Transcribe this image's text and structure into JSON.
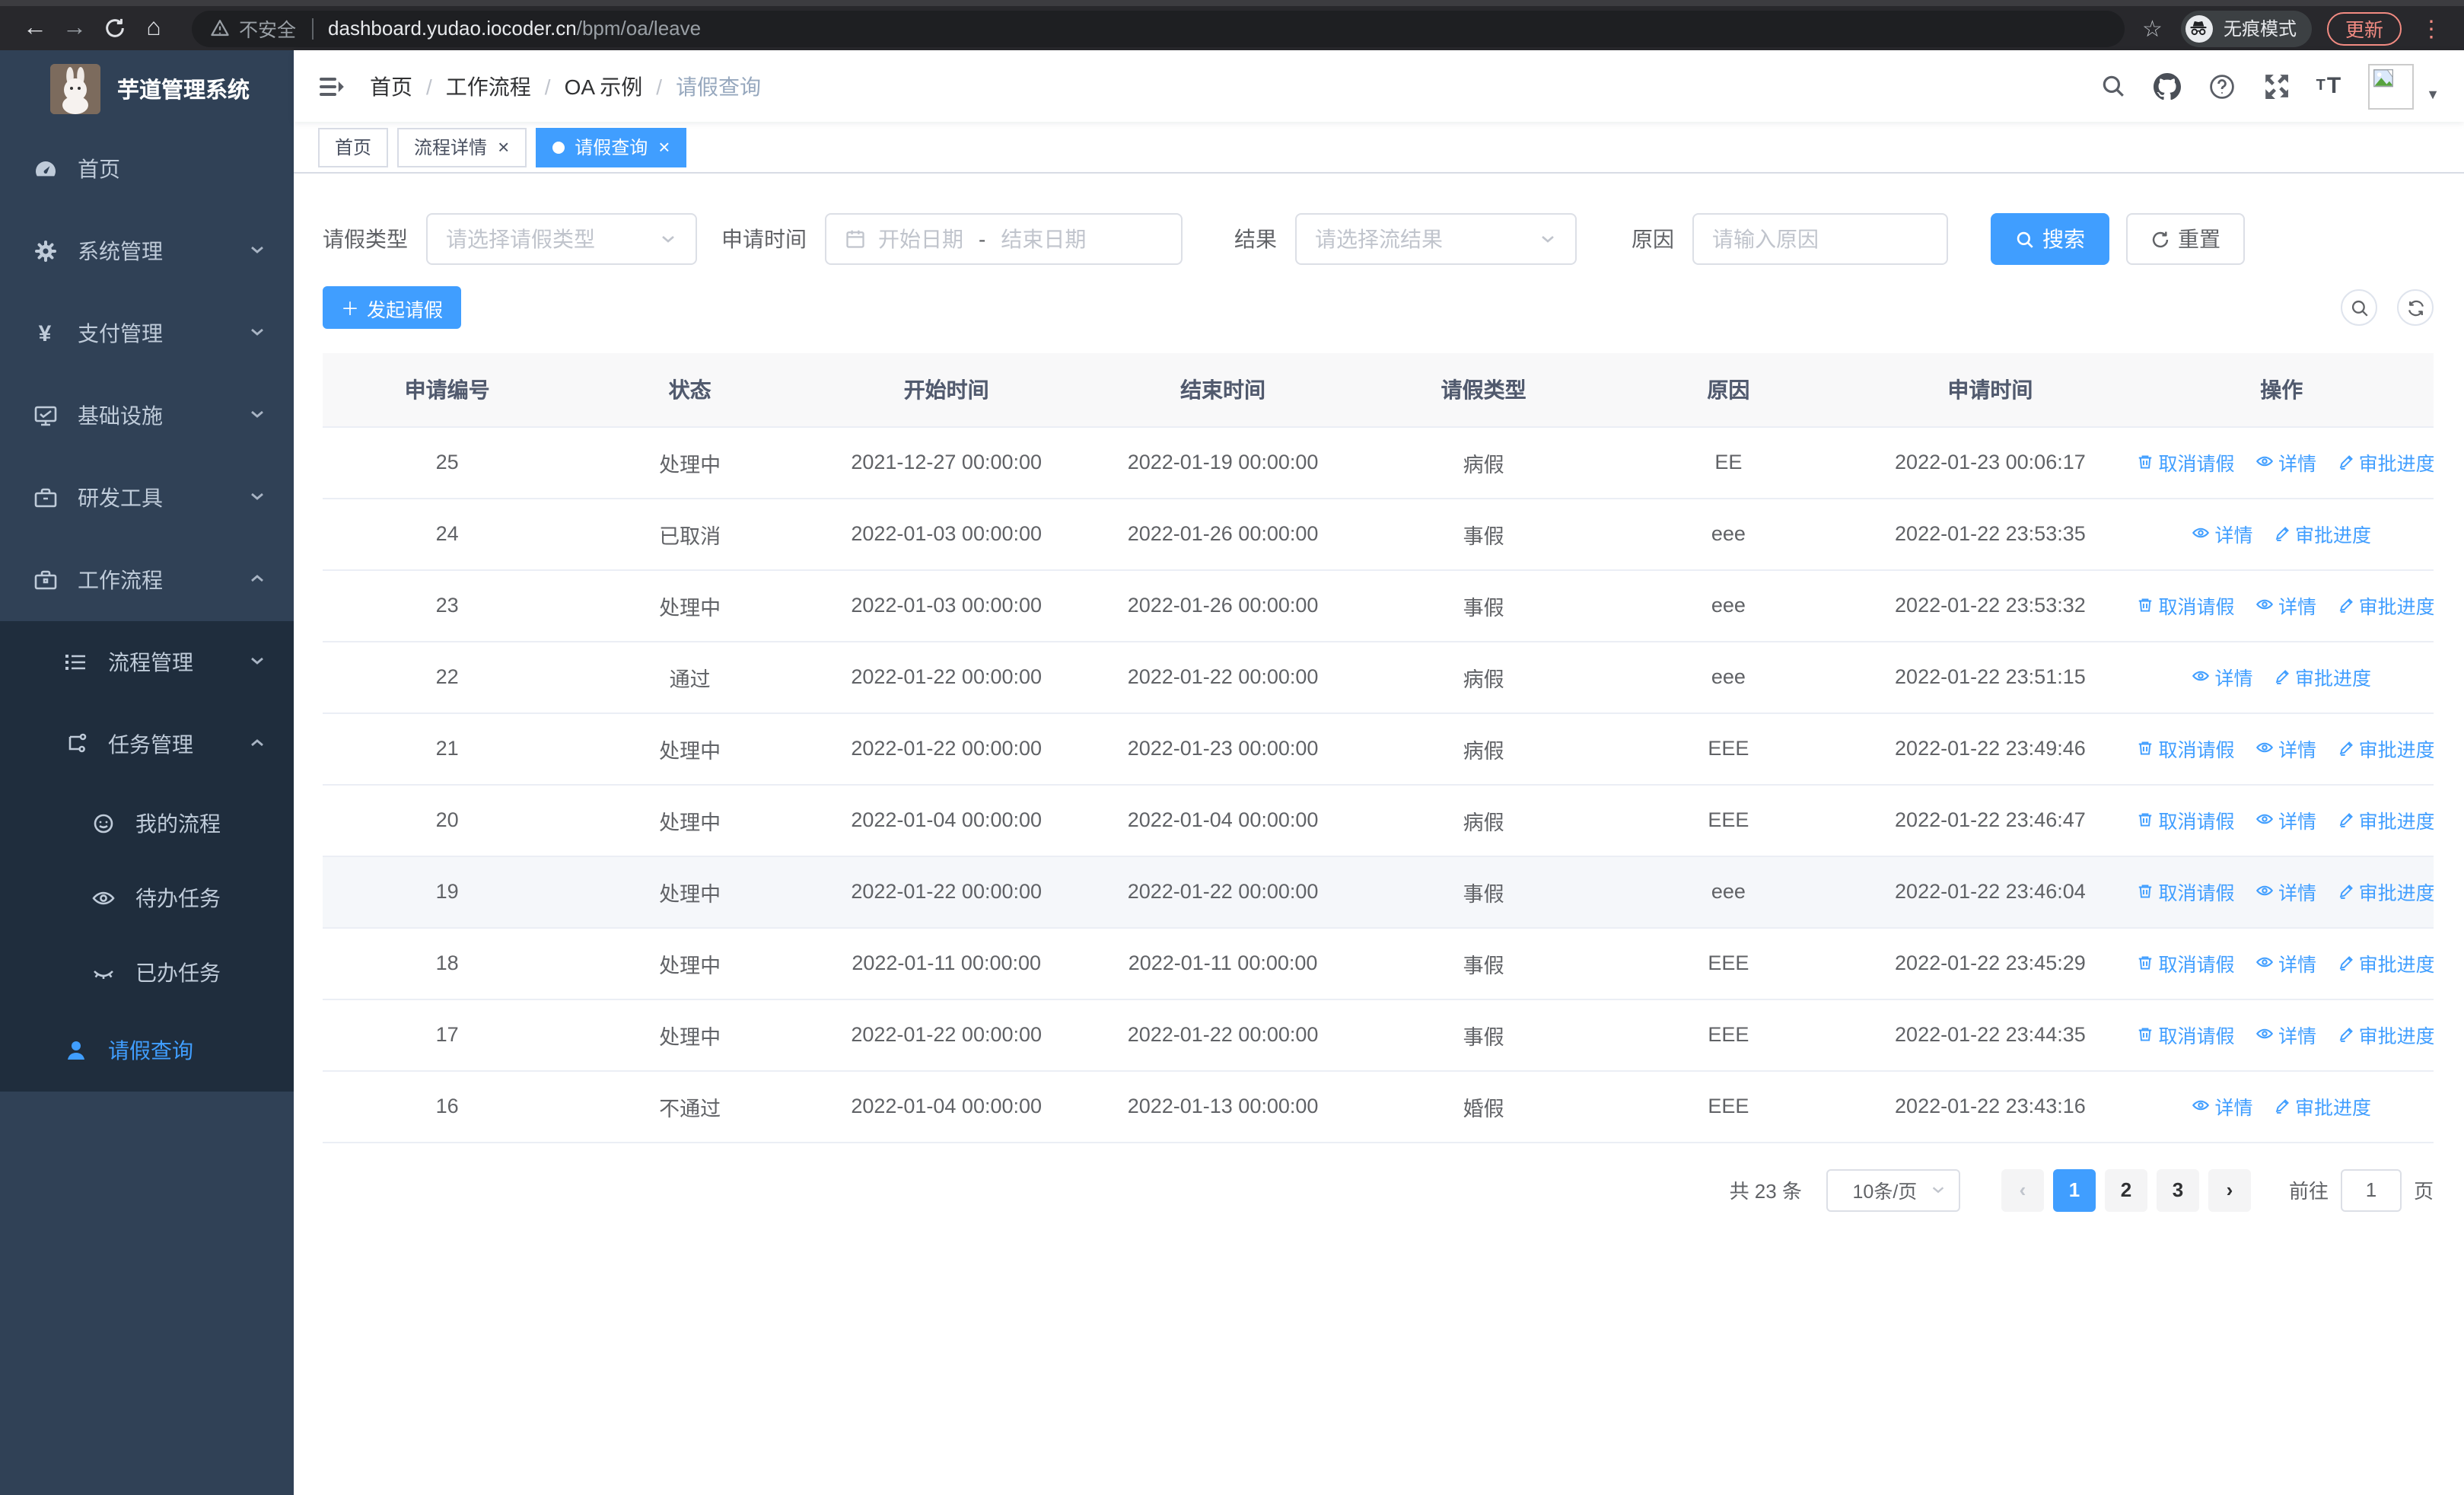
{
  "browser": {
    "security_label": "不安全",
    "url_host": "dashboard.yudao.iocoder.cn",
    "url_path": "/bpm/oa/leave",
    "incognito_label": "无痕模式",
    "update_label": "更新"
  },
  "icons": {
    "back": "←",
    "forward": "→",
    "home": "⌂",
    "star": "☆",
    "kebab": "⋮",
    "breadcrumb_sep": "/",
    "dropdown_caret": "▼",
    "yen": "¥",
    "plus": "＋",
    "close": "×",
    "dot": "",
    "prev": "‹",
    "next": "›"
  },
  "sidebar": {
    "title": "芋道管理系统",
    "items": [
      {
        "label": "首页"
      },
      {
        "label": "系统管理"
      },
      {
        "label": "支付管理"
      },
      {
        "label": "基础设施"
      },
      {
        "label": "研发工具"
      },
      {
        "label": "工作流程"
      },
      {
        "label": "流程管理"
      },
      {
        "label": "任务管理"
      },
      {
        "label": "我的流程"
      },
      {
        "label": "待办任务"
      },
      {
        "label": "已办任务"
      },
      {
        "label": "请假查询"
      }
    ]
  },
  "breadcrumb": [
    "首页",
    "工作流程",
    "OA 示例",
    "请假查询"
  ],
  "tabs": [
    {
      "label": "首页"
    },
    {
      "label": "流程详情"
    },
    {
      "label": "请假查询"
    }
  ],
  "filters": {
    "leave_type_label": "请假类型",
    "leave_type_placeholder": "请选择请假类型",
    "apply_time_label": "申请时间",
    "start_date_placeholder": "开始日期",
    "range_separator": "-",
    "end_date_placeholder": "结束日期",
    "result_label": "结果",
    "result_placeholder": "请选择流结果",
    "reason_label": "原因",
    "reason_placeholder": "请输入原因",
    "search_label": "搜索",
    "reset_label": "重置"
  },
  "toolbar": {
    "create_label": "发起请假"
  },
  "table": {
    "columns": [
      "申请编号",
      "状态",
      "开始时间",
      "结束时间",
      "请假类型",
      "原因",
      "申请时间",
      "操作"
    ],
    "action_labels": {
      "cancel": "取消请假",
      "detail": "详情",
      "progress": "审批进度"
    },
    "rows": [
      {
        "id": "25",
        "status": "处理中",
        "start": "2021-12-27 00:00:00",
        "end": "2022-01-19 00:00:00",
        "type": "病假",
        "reason": "EE",
        "applied": "2022-01-23 00:06:17"
      },
      {
        "id": "24",
        "status": "已取消",
        "start": "2022-01-03 00:00:00",
        "end": "2022-01-26 00:00:00",
        "type": "事假",
        "reason": "eee",
        "applied": "2022-01-22 23:53:35"
      },
      {
        "id": "23",
        "status": "处理中",
        "start": "2022-01-03 00:00:00",
        "end": "2022-01-26 00:00:00",
        "type": "事假",
        "reason": "eee",
        "applied": "2022-01-22 23:53:32"
      },
      {
        "id": "22",
        "status": "通过",
        "start": "2022-01-22 00:00:00",
        "end": "2022-01-22 00:00:00",
        "type": "病假",
        "reason": "eee",
        "applied": "2022-01-22 23:51:15"
      },
      {
        "id": "21",
        "status": "处理中",
        "start": "2022-01-22 00:00:00",
        "end": "2022-01-23 00:00:00",
        "type": "病假",
        "reason": "EEE",
        "applied": "2022-01-22 23:49:46"
      },
      {
        "id": "20",
        "status": "处理中",
        "start": "2022-01-04 00:00:00",
        "end": "2022-01-04 00:00:00",
        "type": "病假",
        "reason": "EEE",
        "applied": "2022-01-22 23:46:47"
      },
      {
        "id": "19",
        "status": "处理中",
        "start": "2022-01-22 00:00:00",
        "end": "2022-01-22 00:00:00",
        "type": "事假",
        "reason": "eee",
        "applied": "2022-01-22 23:46:04"
      },
      {
        "id": "18",
        "status": "处理中",
        "start": "2022-01-11 00:00:00",
        "end": "2022-01-11 00:00:00",
        "type": "事假",
        "reason": "EEE",
        "applied": "2022-01-22 23:45:29"
      },
      {
        "id": "17",
        "status": "处理中",
        "start": "2022-01-22 00:00:00",
        "end": "2022-01-22 00:00:00",
        "type": "事假",
        "reason": "EEE",
        "applied": "2022-01-22 23:44:35"
      },
      {
        "id": "16",
        "status": "不通过",
        "start": "2022-01-04 00:00:00",
        "end": "2022-01-13 00:00:00",
        "type": "婚假",
        "reason": "EEE",
        "applied": "2022-01-22 23:43:16"
      }
    ]
  },
  "pagination": {
    "total_label": "共 23 条",
    "page_size": "10条/页",
    "pages": [
      "1",
      "2",
      "3"
    ],
    "active_page": "1",
    "goto_label": "前往",
    "goto_value": "1",
    "unit_label": "页"
  },
  "colors": {
    "accent": "#409eff",
    "sidebar_bg": "#304156",
    "sidebar_submenu_bg": "#1f2d3d",
    "sidebar_text": "#bfcbd9",
    "chrome_update": "#f28b82",
    "table_header_bg": "#f8f8f9",
    "row_highlight": "#f5f7fa"
  }
}
